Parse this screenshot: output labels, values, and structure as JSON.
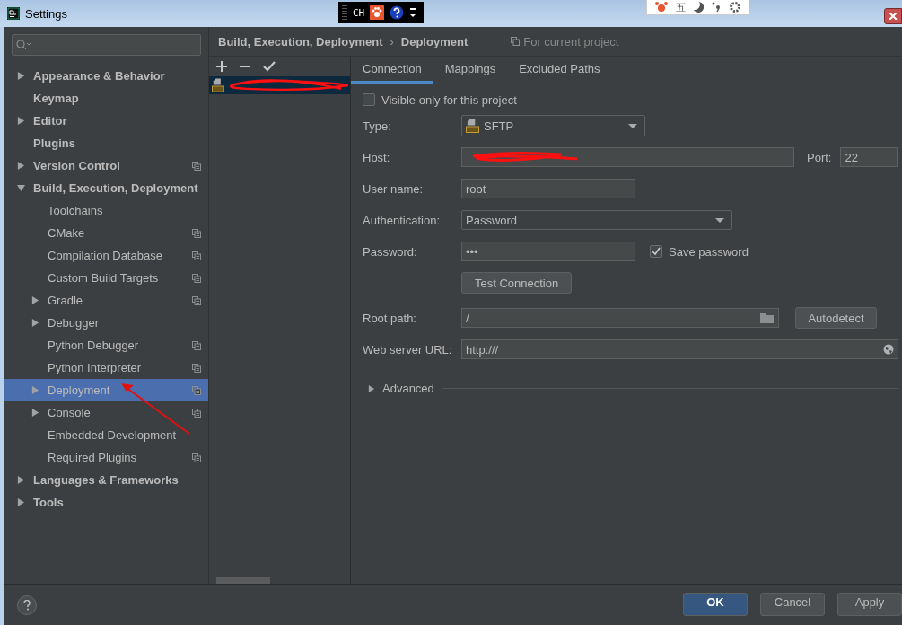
{
  "window": {
    "title": "Settings"
  },
  "ime_bar": {
    "label": "CH"
  },
  "ime_toolbar": {
    "label": "五"
  },
  "sidebar": {
    "items": [
      {
        "label": "Appearance & Behavior",
        "bold": true,
        "expanded": false,
        "selected": false,
        "project": false
      },
      {
        "label": "Keymap",
        "bold": true,
        "selected": false,
        "project": false
      },
      {
        "label": "Editor",
        "bold": true,
        "expanded": false,
        "selected": false,
        "project": false
      },
      {
        "label": "Plugins",
        "bold": true,
        "selected": false,
        "project": false
      },
      {
        "label": "Version Control",
        "bold": true,
        "expanded": false,
        "selected": false,
        "project": true
      },
      {
        "label": "Build, Execution, Deployment",
        "bold": true,
        "expanded": true,
        "selected": false,
        "project": false,
        "children": [
          {
            "label": "Toolchains",
            "selected": false,
            "project": false
          },
          {
            "label": "CMake",
            "selected": false,
            "project": true
          },
          {
            "label": "Compilation Database",
            "selected": false,
            "project": true
          },
          {
            "label": "Custom Build Targets",
            "selected": false,
            "project": true
          },
          {
            "label": "Gradle",
            "expanded": false,
            "selected": false,
            "project": true
          },
          {
            "label": "Debugger",
            "expanded": false,
            "selected": false,
            "project": false
          },
          {
            "label": "Python Debugger",
            "selected": false,
            "project": true
          },
          {
            "label": "Python Interpreter",
            "selected": false,
            "project": true
          },
          {
            "label": "Deployment",
            "expanded": false,
            "selected": true,
            "project": true
          },
          {
            "label": "Console",
            "expanded": false,
            "selected": false,
            "project": true
          },
          {
            "label": "Embedded Development",
            "selected": false,
            "project": false
          },
          {
            "label": "Required Plugins",
            "selected": false,
            "project": true
          }
        ]
      },
      {
        "label": "Languages & Frameworks",
        "bold": true,
        "expanded": false,
        "selected": false,
        "project": false
      },
      {
        "label": "Tools",
        "bold": true,
        "expanded": false,
        "selected": false,
        "project": false
      }
    ]
  },
  "breadcrumb": [
    "Build, Execution, Deployment",
    "Deployment"
  ],
  "breadcrumb_separator": "›",
  "scope_note": "For current project",
  "servers": [
    {
      "selected": true,
      "redacted": true
    }
  ],
  "tabs": [
    {
      "label": "Connection",
      "selected": true
    },
    {
      "label": "Mappings",
      "selected": false
    },
    {
      "label": "Excluded Paths",
      "selected": false
    }
  ],
  "visible_only": {
    "label": "Visible only for this project",
    "checked": false
  },
  "form": {
    "type": {
      "label": "Type:",
      "value": "SFTP"
    },
    "host": {
      "label": "Host:",
      "redacted": true
    },
    "port": {
      "label": "Port:",
      "value": "22"
    },
    "user": {
      "label": "User name:",
      "value": "root"
    },
    "auth": {
      "label": "Authentication:",
      "value": "Password"
    },
    "password": {
      "label": "Password:",
      "value": "•••"
    },
    "save_password": {
      "label": "Save password",
      "checked": true
    },
    "test_button": "Test Connection",
    "root": {
      "label": "Root path:",
      "value": "/"
    },
    "autodetect": "Autodetect",
    "url": {
      "label": "Web server URL:",
      "value": "http:///"
    },
    "advanced": {
      "label": "Advanced",
      "expanded": false
    }
  },
  "annotation_arrow": true,
  "buttons": [
    {
      "label": "OK",
      "primary": true
    },
    {
      "label": "Cancel",
      "primary": false
    },
    {
      "label": "Apply",
      "primary": false
    }
  ]
}
